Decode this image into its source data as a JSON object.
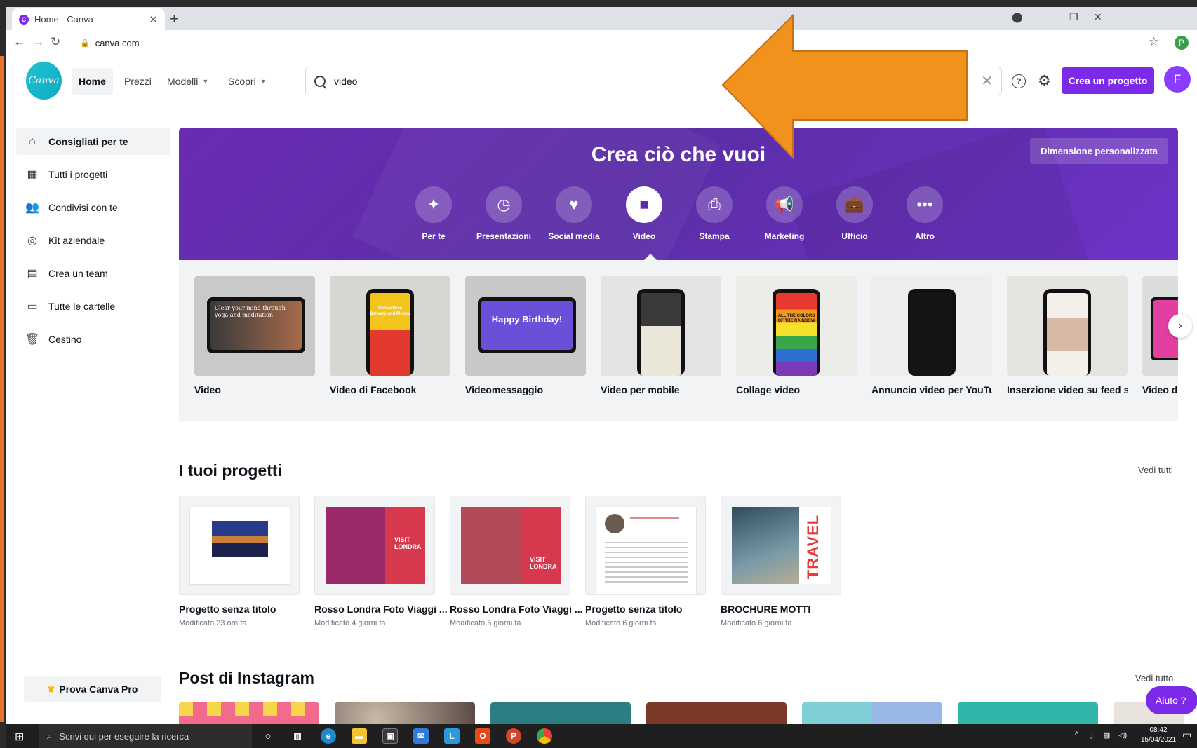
{
  "browser": {
    "tab_title": "Home - Canva",
    "url": "canva.com"
  },
  "nav": {
    "logo": "Canva",
    "home": "Home",
    "pricing": "Prezzi",
    "templates": "Modelli",
    "discover": "Scopri",
    "search_value": "video",
    "create_button": "Crea un progetto",
    "avatar_initial": "F",
    "profile_initial": "P"
  },
  "sidebar": {
    "items": [
      {
        "label": "Consigliati per te",
        "icon": "home-icon"
      },
      {
        "label": "Tutti i progetti",
        "icon": "grid-icon"
      },
      {
        "label": "Condivisi con te",
        "icon": "people-icon"
      },
      {
        "label": "Kit aziendale",
        "icon": "brand-kit-icon"
      },
      {
        "label": "Crea un team",
        "icon": "building-icon"
      },
      {
        "label": "Tutte le cartelle",
        "icon": "folder-icon"
      },
      {
        "label": "Cestino",
        "icon": "trash-icon"
      }
    ],
    "pro_button": "Prova Canva Pro"
  },
  "hero": {
    "title": "Crea ciò che vuoi",
    "custom_size": "Dimensione personalizzata",
    "categories": [
      {
        "label": "Per te",
        "icon": "sparkle-icon"
      },
      {
        "label": "Presentazioni",
        "icon": "presentation-icon"
      },
      {
        "label": "Social media",
        "icon": "heart-icon"
      },
      {
        "label": "Video",
        "icon": "video-camera-icon"
      },
      {
        "label": "Stampa",
        "icon": "print-icon"
      },
      {
        "label": "Marketing",
        "icon": "megaphone-icon"
      },
      {
        "label": "Ufficio",
        "icon": "briefcase-icon"
      },
      {
        "label": "Altro",
        "icon": "more-icon"
      }
    ],
    "active_category": "Video"
  },
  "templates": [
    {
      "label": "Video"
    },
    {
      "label": "Video di Facebook"
    },
    {
      "label": "Videomessaggio"
    },
    {
      "label": "Video per mobile"
    },
    {
      "label": "Collage video"
    },
    {
      "label": "Annuncio video per YouTu..."
    },
    {
      "label": "Inserzione video su feed s..."
    },
    {
      "label": "Video di"
    }
  ],
  "template_thumb_text": {
    "video": "Clear your mind through yoga and meditation",
    "facebook": "Contactless Delivery and Pickup",
    "message": "Happy Birthday!",
    "collage": "ALL THE COLORS OF THE RAINBOW"
  },
  "projects": {
    "title": "I tuoi progetti",
    "see_all": "Vedi tutti",
    "items": [
      {
        "name": "Progetto senza titolo",
        "modified": "Modificato 23 ore fa"
      },
      {
        "name": "Rosso Londra Foto Viaggi ...",
        "modified": "Modificato 4 giorni fa",
        "overlay": "VISIT LONDRA"
      },
      {
        "name": "Rosso Londra Foto Viaggi ...",
        "modified": "Modificato 5 giorni fa",
        "overlay": "VISIT LONDRA"
      },
      {
        "name": "Progetto senza titolo",
        "modified": "Modificato 6 giorni fa"
      },
      {
        "name": "BROCHURE MOTTI",
        "modified": "Modificato 6 giorni fa",
        "overlay": "TRAVEL"
      }
    ]
  },
  "instagram": {
    "title": "Post di Instagram",
    "see_all": "Vedi tutto"
  },
  "help_button": "Aiuto ?",
  "taskbar": {
    "search_placeholder": "Scrivi qui per eseguire la ricerca",
    "time": "08:42",
    "date": "15/04/2021"
  },
  "colors": {
    "brand_purple": "#7d2ae8",
    "hero_purple": "#5b2ea6",
    "arrow_orange": "#f0921b"
  }
}
